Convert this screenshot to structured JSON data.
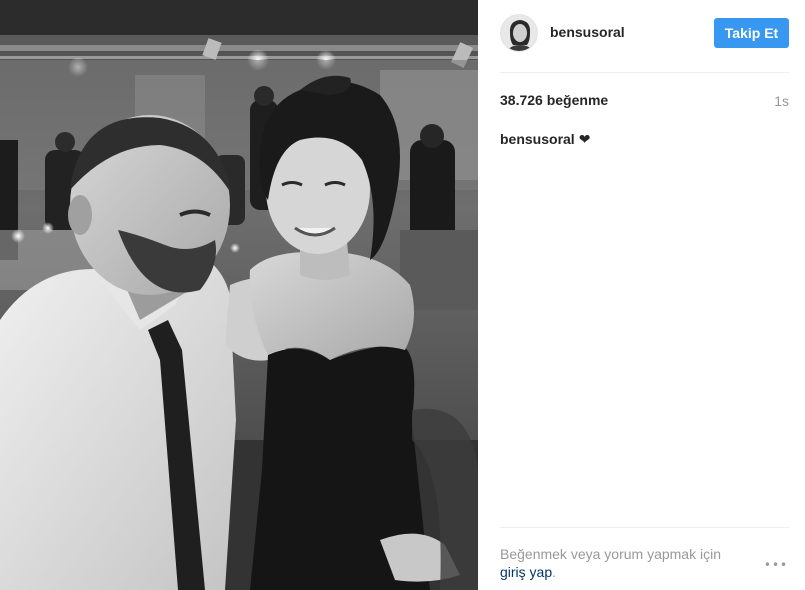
{
  "post": {
    "photo_alt": "Siyah beyaz fotoğraf",
    "header": {
      "username": "bensusoral",
      "follow_label": "Takip Et"
    },
    "stats": {
      "likes": "38.726 beğenme",
      "time": "1s"
    },
    "caption": {
      "username": "bensusoral",
      "text": "❤"
    },
    "footer": {
      "login_prompt": "Beğenmek veya yorum yapmak için",
      "login_link": "giriş yap",
      "login_suffix": ".",
      "more_label": "•••"
    }
  },
  "colors": {
    "accent": "#3897f0",
    "link": "#003569",
    "muted": "#999999",
    "text": "#262626",
    "divider": "#efefef"
  },
  "icons": [
    "avatar",
    "heart-icon",
    "more-options-icon"
  ]
}
